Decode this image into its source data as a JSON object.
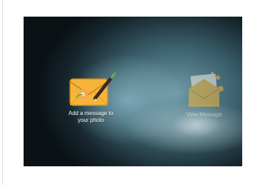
{
  "screen": {
    "tiles": [
      {
        "label": "Add a message to\nyour photo",
        "icon": "envelope-pencil-icon"
      },
      {
        "label": "View Message",
        "icon": "open-envelope-letter-icon"
      }
    ]
  },
  "colors": {
    "envelope": "#f4b53a",
    "envelope_dark": "#d88d17",
    "flower": "#f7a55a",
    "leaf": "#6fae3b",
    "background_glow": "#7fa8b4"
  }
}
